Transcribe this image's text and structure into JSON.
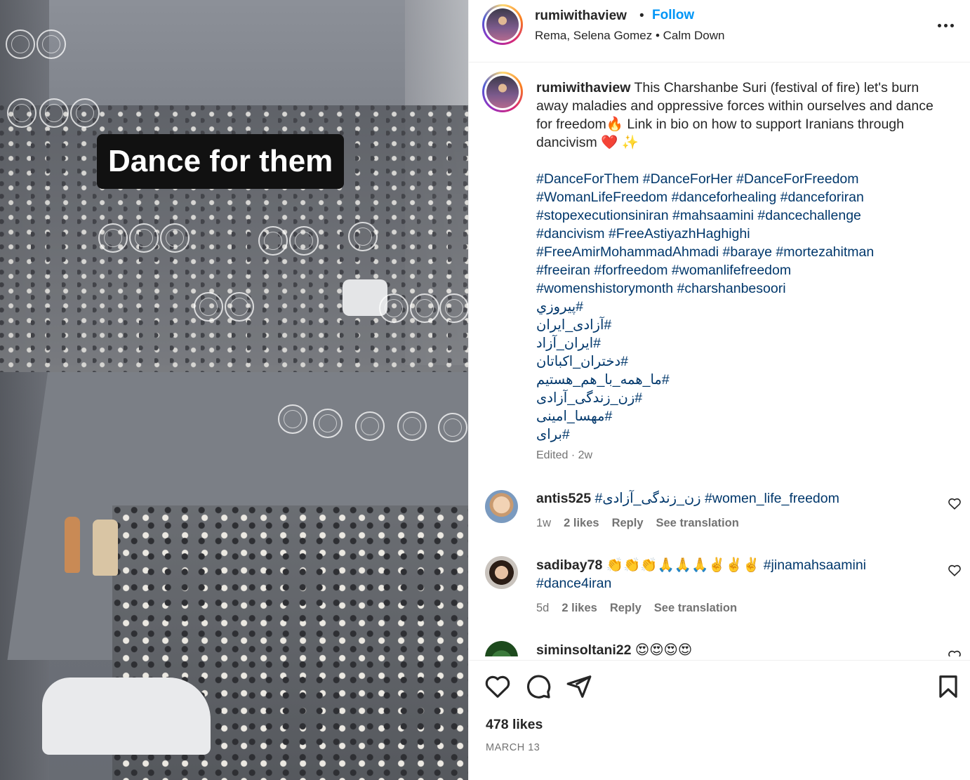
{
  "media": {
    "overlay_text": "Dance for them"
  },
  "header": {
    "username": "rumiwithaview",
    "separator": "•",
    "follow_label": "Follow",
    "audio": "Rema, Selena Gomez • Calm Down"
  },
  "caption": {
    "username": "rumiwithaview",
    "text": "This Charshanbe Suri (festival of fire) let's burn away maladies and oppressive forces within ourselves and dance for freedom🔥 Link in bio on how to support Iranians through dancivism ❤️ ✨",
    "hashtags": "#DanceForThem #DanceForHer #DanceForFreedom\n#WomanLifeFreedom #danceforhealing #danceforiran\n#stopexecutionsiniran #mahsaamini #dancechallenge\n#dancivism #FreeAstiyazhHaghighi\n#FreeAmirMohammadAhmadi #baraye #mortezahitman\n#freeiran #forfreedom #womanlifefreedom\n#womenshistorymonth #charshanbesoori",
    "persian_tags": [
      "#پیروزي",
      "#آزادی_ایران",
      "#ایران_آزاد",
      "#دختران_اکباتان",
      "#ما_همه_با_هم_هستیم",
      "#زن_زندگی_آزادی",
      "#مهسا_امینی",
      "#برای"
    ],
    "meta": "Edited · 2w"
  },
  "comments": [
    {
      "username": "antis525",
      "text": "#زن_زندگی_آزادی #women_life_freedom",
      "time": "1w",
      "likes": "2 likes",
      "reply": "Reply",
      "translate": "See translation"
    },
    {
      "username": "sadibay78",
      "emojis": "👏👏👏🙏🙏🙏✌️✌️✌️",
      "text": "#jinamahsaamini\n#dance4iran",
      "time": "5d",
      "likes": "2 likes",
      "reply": "Reply",
      "translate": "See translation"
    },
    {
      "username": "siminsoltani22",
      "text": "😍😍😍😍"
    }
  ],
  "footer": {
    "likes": "478 likes",
    "date": "MARCH 13"
  }
}
